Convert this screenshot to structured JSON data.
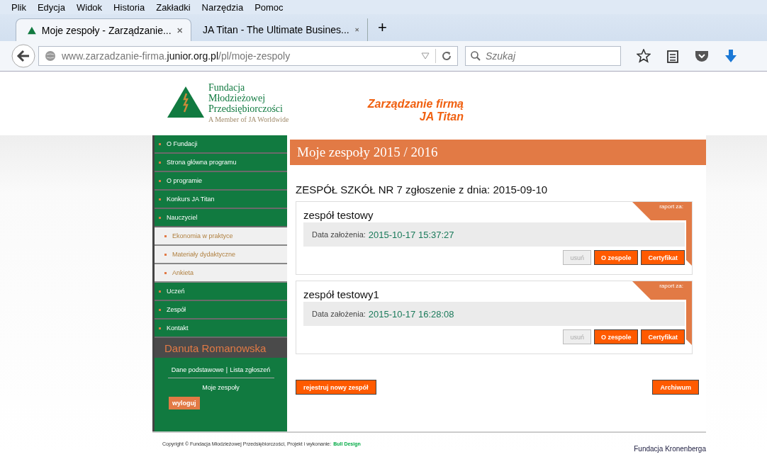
{
  "menu_bar": [
    "Plik",
    "Edycja",
    "Widok",
    "Historia",
    "Zakładki",
    "Narzędzia",
    "Pomoc"
  ],
  "tabs": [
    {
      "title": "Moje zespoły - Zarządzanie...",
      "selected": true,
      "has_icon": true
    },
    {
      "title": "JA Titan - The Ultimate Busines...",
      "selected": false,
      "has_icon": false
    }
  ],
  "new_tab": "+",
  "address_bar": {
    "prefix": "www.zarzadzanie-firma.",
    "domain": "junior.org.pl",
    "path": "/pl/moje-zespoly"
  },
  "search": {
    "placeholder": "Szukaj"
  },
  "header": {
    "logo_lines": [
      "Fundacja",
      "Młodzieżowej",
      "Przedsiębiorczości"
    ],
    "logo_tagline": "A Member of JA Worldwide",
    "title_lines": [
      "Zarządzanie firmą",
      "JA Titan"
    ]
  },
  "sidebar": {
    "items": [
      {
        "label": "O Fundacji"
      },
      {
        "label": "Strona główna programu"
      },
      {
        "label": "O programie"
      },
      {
        "label": "Konkurs JA Titan"
      },
      {
        "label": "Nauczyciel",
        "children": [
          {
            "label": "Ekonomia w praktyce"
          },
          {
            "label": "Materiały dydaktyczne"
          },
          {
            "label": "Ankieta"
          }
        ]
      },
      {
        "label": "Uczeń"
      },
      {
        "label": "Zespół"
      },
      {
        "label": "Kontakt"
      }
    ],
    "user": {
      "name": "Danuta Romanowska",
      "links": [
        "Dane podstawowe",
        "Lista zgłoszeń"
      ],
      "separator": "|",
      "current": "Moje zespoły",
      "logout": "wyloguj"
    }
  },
  "content": {
    "heading": "Moje zespoły 2015 / 2016",
    "school": "ZESPÓŁ SZKÓŁ NR 7 zgłoszenie z dnia: 2015-09-10",
    "teams": [
      {
        "name": "zespół testowy",
        "corner": "raport za:",
        "date_label": "Data założenia:",
        "date": "2015-10-17 15:37:27",
        "buttons": [
          {
            "label": "usuń",
            "disabled": true
          },
          {
            "label": "O zespole",
            "disabled": false
          },
          {
            "label": "Certyfikat",
            "disabled": false
          }
        ]
      },
      {
        "name": "zespół testowy1",
        "corner": "raport za:",
        "date_label": "Data założenia:",
        "date": "2015-10-17 16:28:08",
        "buttons": [
          {
            "label": "usuń",
            "disabled": true
          },
          {
            "label": "O zespole",
            "disabled": false
          },
          {
            "label": "Certyfikat",
            "disabled": false
          }
        ]
      }
    ],
    "register_button": "rejestruj nowy zespół",
    "archive_button": "Archiwum"
  },
  "footer": {
    "copyright": "Copyright © Fundacja Młodzieżowej Przedsiębiorczości, Projekt i wykonanie:",
    "credit_link": "Bull Design",
    "partner": "Fundacja Kronenberga"
  }
}
